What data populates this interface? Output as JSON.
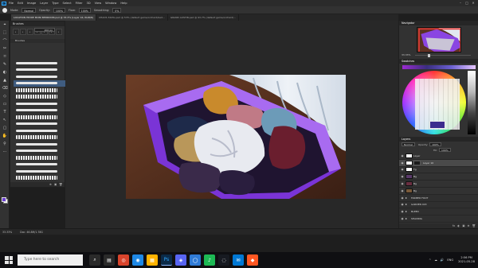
{
  "menubar": {
    "logo": "Ps",
    "items": [
      "File",
      "Edit",
      "Image",
      "Layer",
      "Type",
      "Select",
      "Filter",
      "3D",
      "View",
      "Window",
      "Help"
    ],
    "window_controls": [
      "–",
      "□",
      "✕"
    ]
  },
  "options": {
    "opacity_label": "Opacity:",
    "opacity_value": "100%",
    "flow_label": "Flow:",
    "flow_value": "100%",
    "mode_label": "Mode:",
    "mode_value": "Normal",
    "smoothing_label": "Smoothing:",
    "smoothing_value": "0%"
  },
  "tabs": [
    {
      "label": "LOCATION HIDDE MONI BEDROOM.psd @ 33.3% (Layer 16, RGB/8)",
      "active": true
    },
    {
      "label": "CHAOS 3445s.psd @ 53% (default game/orchard/bed…",
      "active": false
    },
    {
      "label": "GRAND AUSTIN.psd @ 93.7% (default game/orchard/…",
      "active": false
    }
  ],
  "tools": [
    "⌖",
    "⬚",
    "⌒",
    "✂",
    "⌑",
    "✎",
    "◐",
    "▲",
    "⌫",
    "◇",
    "▭",
    "T",
    "↖",
    "▢",
    "✋",
    "⚲",
    "⋯"
  ],
  "brushes": {
    "title": "Brushes",
    "presets": [
      "•",
      "•",
      "•",
      "•",
      "•",
      "•",
      "•"
    ],
    "size": "200 px",
    "folder": "Brushes",
    "footer": [
      "⊕",
      "▣",
      "🗑"
    ]
  },
  "navigator": {
    "tabs": [
      "Navigator"
    ],
    "zoom": "33.33%"
  },
  "swatches": {
    "tabs": [
      "Swatches"
    ]
  },
  "layers": {
    "tabs": [
      "Layers"
    ],
    "blend_mode": "Normal",
    "opacity_label": "Opacity:",
    "opacity": "100%",
    "fill_label": "Fill:",
    "fill": "100%",
    "items": [
      {
        "name": "Layer",
        "type": "layer",
        "selected": false
      },
      {
        "name": "Layer 16",
        "type": "layer",
        "selected": true
      },
      {
        "name": "Fg",
        "type": "layer",
        "selected": false
      },
      {
        "name": "Bg",
        "type": "layer",
        "selected": false
      },
      {
        "name": "Bg",
        "type": "layer",
        "selected": false
      },
      {
        "name": "Bg",
        "type": "layer",
        "selected": false
      },
      {
        "name": "FARMER FOOT",
        "type": "folder",
        "selected": false
      },
      {
        "name": "GARDEN 043",
        "type": "folder",
        "selected": false
      },
      {
        "name": "BLEED",
        "type": "folder",
        "selected": false
      },
      {
        "name": "SHADING",
        "type": "folder",
        "selected": false
      }
    ],
    "footer": [
      "fx",
      "◐",
      "▣",
      "⊕",
      "🗑"
    ]
  },
  "status": {
    "zoom": "33.33%",
    "doc": "Doc: 46.8M/1.78G"
  },
  "taskbar": {
    "search_placeholder": "Type here to search",
    "apps": [
      {
        "icon": "⌕",
        "color": "#2a2a2a"
      },
      {
        "icon": "▤",
        "color": "#2a2a2a"
      },
      {
        "icon": "◎",
        "color": "#d8442c"
      },
      {
        "icon": "◉",
        "color": "#1e88e5"
      },
      {
        "icon": "▦",
        "color": "#ffb300"
      },
      {
        "icon": "Ps",
        "color": "#0b2a47"
      },
      {
        "icon": "◈",
        "color": "#5865f2"
      },
      {
        "icon": "◯",
        "color": "#2f7bd6"
      },
      {
        "icon": "♪",
        "color": "#1db954"
      },
      {
        "icon": "◌",
        "color": "#171a21"
      },
      {
        "icon": "✉",
        "color": "#0078d4"
      },
      {
        "icon": "◆",
        "color": "#ff5722"
      }
    ],
    "tray_items": [
      "^",
      "☁",
      "🔊",
      "ENG"
    ],
    "time": "2:56 PM",
    "date": "2021-05-28"
  }
}
